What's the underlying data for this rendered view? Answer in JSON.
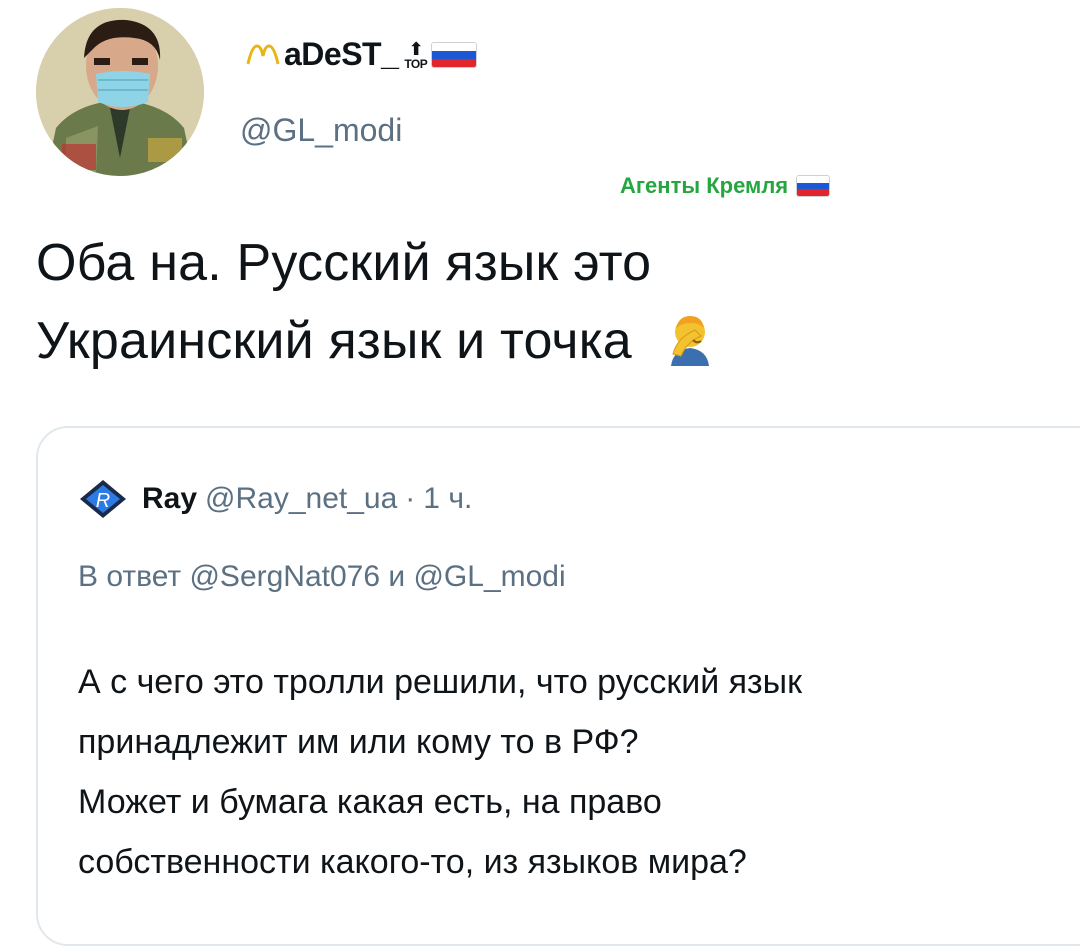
{
  "author": {
    "display_name": "aDeST_",
    "top_label": "ТОР",
    "handle": "@GL_modi",
    "label": "Агенты Кремля",
    "avatar": "profile-avatar"
  },
  "tweet": {
    "lines": [
      "Оба на. Русский язык это",
      "Украинский язык и точка"
    ],
    "emoji": "facepalm"
  },
  "quote": {
    "name": "Ray",
    "handle": "@Ray_net_ua",
    "separator": "·",
    "time": "1 ч.",
    "reply_to": "В ответ @SergNat076 и @GL_modi",
    "lines": [
      "А с чего это тролли решили, что русский язык",
      "принадлежит им или кому то в РФ?",
      "Может и бумага какая есть, на право",
      "собственности какого-то, из языков мира?"
    ]
  },
  "colors": {
    "secondary_text": "#5b7083",
    "label_green": "#26a640",
    "border": "#e1e8ed",
    "flag": [
      "#ffffff",
      "#1c57d6",
      "#e0262b"
    ]
  }
}
